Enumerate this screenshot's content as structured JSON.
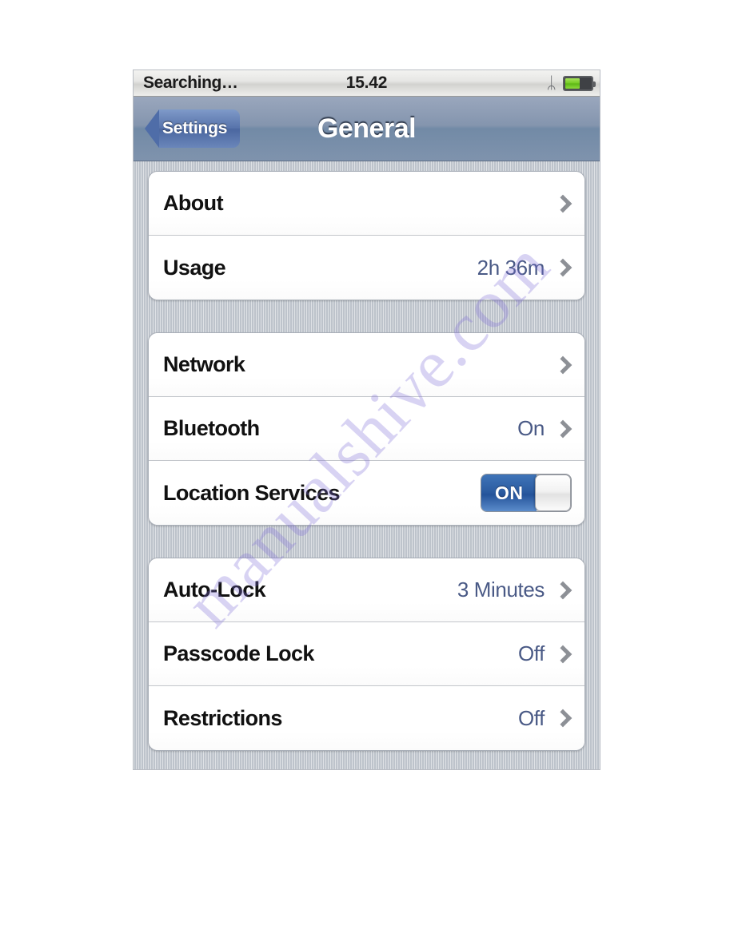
{
  "status_bar": {
    "carrier": "Searching…",
    "time": "15.42",
    "bluetooth_icon": "bluetooth-icon",
    "bluetooth_glyph": "ᛦ",
    "battery_icon": "battery-icon",
    "battery_level_percent": 53
  },
  "nav_bar": {
    "back_label": "Settings",
    "title": "General"
  },
  "colors": {
    "accent_blue": "#2c5da2",
    "value_blue": "#4a5a86",
    "nav_blue": "#7f93ad",
    "battery_green": "#74cb22",
    "watermark": "#7e6ed6"
  },
  "groups": [
    {
      "rows": [
        {
          "label": "About",
          "value": "",
          "accessory": "chevron"
        },
        {
          "label": "Usage",
          "value": "2h 36m",
          "accessory": "chevron"
        }
      ]
    },
    {
      "rows": [
        {
          "label": "Network",
          "value": "",
          "accessory": "chevron"
        },
        {
          "label": "Bluetooth",
          "value": "On",
          "accessory": "chevron"
        },
        {
          "label": "Location Services",
          "value": "",
          "accessory": "switch",
          "switch_label": "ON",
          "switch_state": "on"
        }
      ]
    },
    {
      "rows": [
        {
          "label": "Auto-Lock",
          "value": "3 Minutes",
          "accessory": "chevron"
        },
        {
          "label": "Passcode Lock",
          "value": "Off",
          "accessory": "chevron"
        },
        {
          "label": "Restrictions",
          "value": "Off",
          "accessory": "chevron"
        }
      ]
    }
  ],
  "watermark": {
    "text": "manualshive.com"
  }
}
